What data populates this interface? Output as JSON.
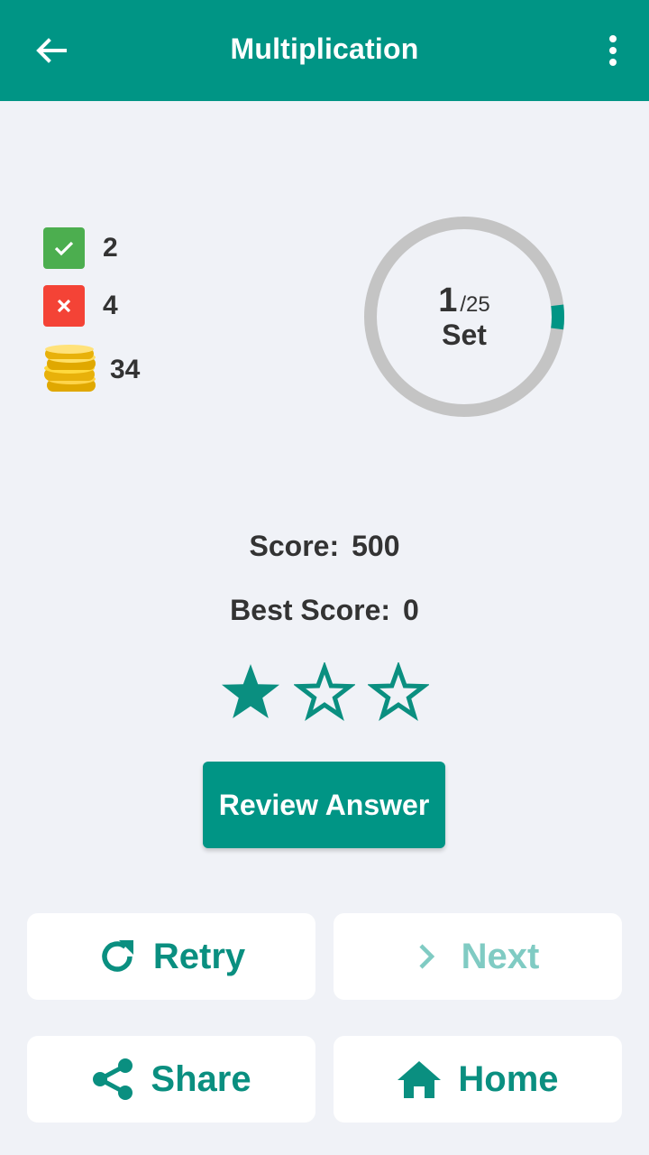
{
  "appbar": {
    "title": "Multiplication",
    "back_icon": "arrow-left-icon",
    "menu_icon": "more-vert-icon",
    "color": "#009585"
  },
  "stats": {
    "correct": "2",
    "wrong": "4",
    "coins": "34",
    "correct_color": "#4cae4f",
    "wrong_color": "#f44336"
  },
  "progress": {
    "current": "1",
    "total": "/25",
    "label": "Set",
    "fraction": 0.04
  },
  "score": {
    "label": "Score:",
    "value": "500",
    "best_label": "Best Score:",
    "best_value": "0"
  },
  "rating": {
    "stars_filled": 1,
    "stars_total": 3
  },
  "actions": {
    "review": "Review Answer",
    "retry": "Retry",
    "next": "Next",
    "share": "Share",
    "home": "Home"
  }
}
